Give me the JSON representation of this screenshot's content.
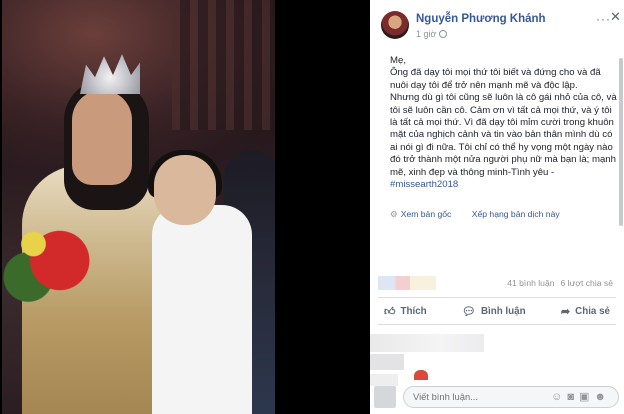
{
  "post": {
    "author": "Nguyễn Phương Khánh",
    "time": "1 giờ",
    "body": "Mẹ,\nÔng đã dạy tôi mọi thứ tôi biết và đứng cho và đã nuôi dạy tôi để trở nên mạnh mẽ và độc lập.\nNhưng dù gì tôi cũng sẽ luôn là cô gái nhỏ của cô, và tôi sẽ luôn cần cô. Cảm ơn vì tất cả mọi thứ, và ý tôi là tất cả mọi thứ. Vì đã dạy tôi mỉm cười trong khuôn mặt của nghịch cảnh và tin vào bản thân mình dù có ai nói gì đi nữa. Tôi chỉ có thể hy vọng một ngày nào đó trở thành một nửa người phụ nữ mà bạn là; mạnh mẽ, xinh đẹp và thông minh-Tình yêu -",
    "hashtag": "#missearth2018",
    "see_original": "Xem bản gốc",
    "rate_translation": "Xếp hạng bản dịch này",
    "comments_count": "41 bình luận",
    "shares_count": "6 lượt chia sẻ"
  },
  "actions": {
    "like": "Thích",
    "comment": "Bình luận",
    "share": "Chia sẻ"
  },
  "composer": {
    "placeholder": "Viết bình luận..."
  },
  "icons": {
    "more": "more-icon",
    "close": "close-icon",
    "globe": "globe-icon",
    "like": "thumbs-up-icon",
    "comment": "comment-bubble-icon",
    "share": "share-arrow-icon",
    "settings": "gear-icon"
  },
  "colors": {
    "link": "#365899",
    "muted": "#90949c",
    "action": "#606770"
  }
}
